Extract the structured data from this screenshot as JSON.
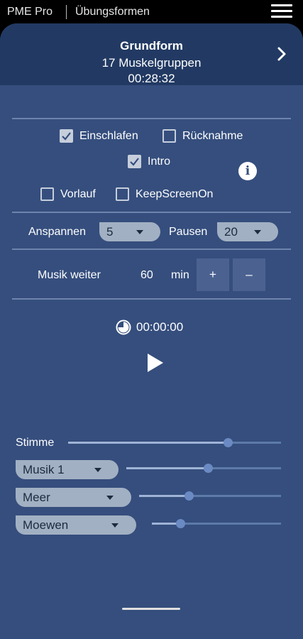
{
  "topbar": {
    "app_name": "PME Pro",
    "section": "Übungsformen"
  },
  "header": {
    "title": "Grundform",
    "subtitle": "17 Muskelgruppen"
  },
  "timer": "00:28:32",
  "options": {
    "einschlafen": {
      "label": "Einschlafen",
      "checked": true
    },
    "ruecknahme": {
      "label": "Rücknahme",
      "checked": false
    },
    "intro": {
      "label": "Intro",
      "checked": true
    },
    "vorlauf": {
      "label": "Vorlauf",
      "checked": false
    },
    "keepscreenon": {
      "label": "KeepScreenOn",
      "checked": false
    }
  },
  "anspannen": {
    "label": "Anspannen",
    "value": "5"
  },
  "pausen": {
    "label": "Pausen",
    "value": "20"
  },
  "musik_weiter": {
    "label": "Musik weiter",
    "value": "60",
    "unit": "min",
    "plus": "+",
    "minus": "–"
  },
  "elapsed": "00:00:00",
  "mixer": {
    "stimme": {
      "label": "Stimme",
      "level": 0.75
    },
    "musik": {
      "label": "Musik 1",
      "level": 0.53
    },
    "meer": {
      "label": "Meer",
      "level": 0.35
    },
    "moewen": {
      "label": "Moewen",
      "level": 0.22
    }
  },
  "colors": {
    "background": "#354e7d",
    "header": "#223a63",
    "pill": "#a2b0c3"
  }
}
